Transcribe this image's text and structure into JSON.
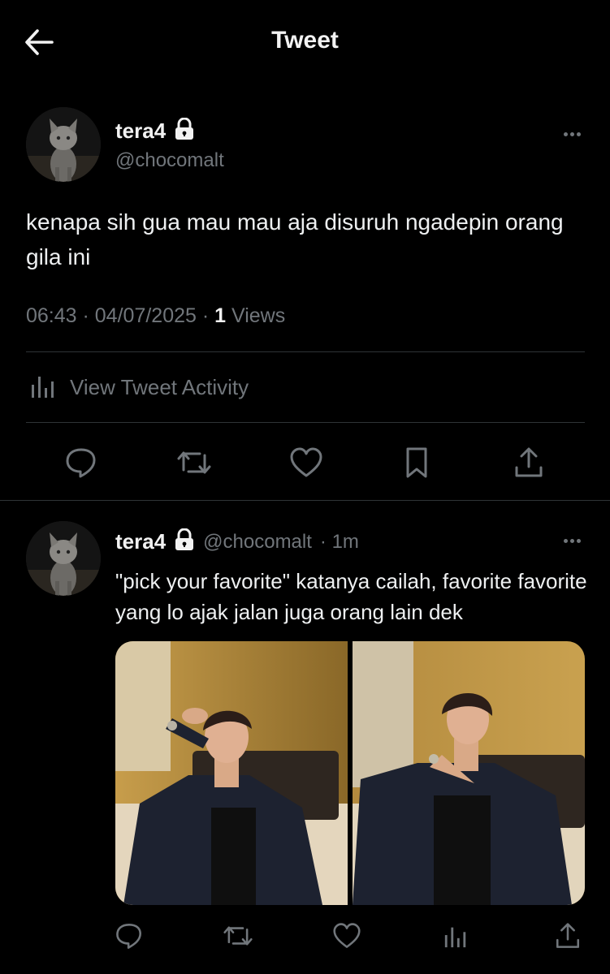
{
  "header": {
    "title": "Tweet",
    "back_icon": "arrow-left-icon"
  },
  "main_tweet": {
    "display_name": "tera4",
    "protected_icon": "lock-icon",
    "handle": "@chocomalt",
    "avatar": "cat-avatar",
    "text": "kenapa sih gua mau mau aja disuruh ngadepin orang gila ini",
    "time": "06:43",
    "date": "04/07/2025",
    "views_count": "1",
    "views_label": "Views",
    "activity_label": "View Tweet Activity",
    "actions": [
      "reply-icon",
      "retweet-icon",
      "like-icon",
      "bookmark-icon",
      "share-icon"
    ]
  },
  "reply_tweet": {
    "display_name": "tera4",
    "protected_icon": "lock-icon",
    "handle": "@chocomalt",
    "time_ago": "· 1m",
    "text": "\"pick your favorite\" katanya cailah, favorite favorite yang lo ajak jalan juga orang lain dek",
    "media_count": 2,
    "actions": [
      "reply-icon",
      "retweet-icon",
      "like-icon",
      "views-icon",
      "share-icon"
    ]
  },
  "colors": {
    "background": "#000000",
    "text": "#e7e9ea",
    "muted": "#71767b",
    "divider": "#2f3336"
  }
}
